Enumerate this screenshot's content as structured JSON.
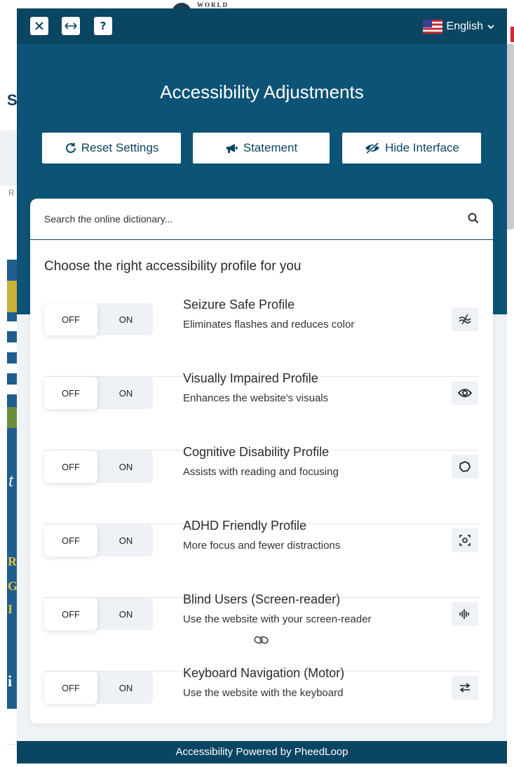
{
  "background": {
    "logo_text": "WORLD"
  },
  "topbar": {
    "close_label": "✕",
    "expand_label": "↔",
    "help_label": "?",
    "language": "English"
  },
  "header": {
    "title": "Accessibility Adjustments",
    "buttons": {
      "reset": "Reset Settings",
      "statement": "Statement",
      "hide": "Hide Interface"
    }
  },
  "search": {
    "placeholder": "Search the online dictionary..."
  },
  "profiles_heading": "Choose the right accessibility profile for you",
  "toggle_labels": {
    "off": "OFF",
    "on": "ON"
  },
  "profiles": [
    {
      "title": "Seizure Safe Profile",
      "description": "Eliminates flashes and reduces color",
      "icon": "seizure-icon",
      "state": "OFF"
    },
    {
      "title": "Visually Impaired Profile",
      "description": "Enhances the website's visuals",
      "icon": "eye-icon",
      "state": "OFF"
    },
    {
      "title": "Cognitive Disability Profile",
      "description": "Assists with reading and focusing",
      "icon": "circle-icon",
      "state": "OFF"
    },
    {
      "title": "ADHD Friendly Profile",
      "description": "More focus and fewer distractions",
      "icon": "focus-icon",
      "state": "OFF"
    },
    {
      "title": "Blind Users (Screen-reader)",
      "description": "Use the website with your screen-reader",
      "icon": "audio-wave-icon",
      "state": "OFF"
    },
    {
      "title": "Keyboard Navigation (Motor)",
      "description": "Use the website with the keyboard",
      "icon": "arrows-swap-icon",
      "state": "OFF"
    }
  ],
  "footer": {
    "text": "Accessibility Powered by PheedLoop"
  },
  "colors": {
    "panel": "#0d5375",
    "topbar": "#0a4561",
    "panel_bg": "#f0f3f6"
  }
}
